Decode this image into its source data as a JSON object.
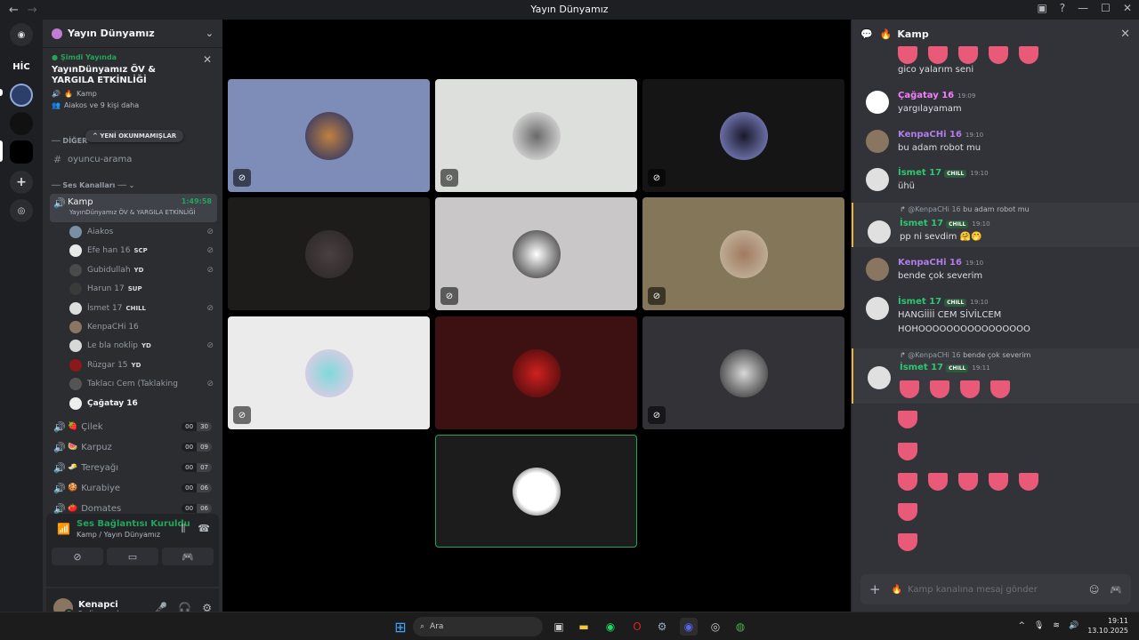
{
  "window": {
    "title": "Yayın Dünyamız"
  },
  "rail": {
    "servers": [
      "HİC"
    ]
  },
  "sidebar": {
    "server_name": "Yayın Dünyamız",
    "live": {
      "now_label": "Şimdi Yayında",
      "event_title": "YayınDünyamız ÖV & YARGILA ETKİNLİĞİ",
      "channel": "Kamp",
      "audience": "Aiakos ve 9 kişi daha"
    },
    "unread_label": "YENİ OKUNMAMIŞLAR",
    "category_other": "DİĞER",
    "text_channel": "oyuncu-arama",
    "category_voice": "Ses Kanalları",
    "active_channel": {
      "name": "Kamp",
      "timer": "1:49:58",
      "subtitle": "YayınDünyamız ÖV & YARGILA ETKİNLİĞİ"
    },
    "members": [
      {
        "name": "Aiakos",
        "tag": "",
        "color": "#7a8fa6"
      },
      {
        "name": "Efe han 16",
        "tag": "SCP",
        "color": "#e8e8e8"
      },
      {
        "name": "Gubidullah",
        "tag": "YD",
        "color": "#4a4a4a"
      },
      {
        "name": "Harun 17",
        "tag": "SUP",
        "color": "#3a3a3a"
      },
      {
        "name": "İsmet 17",
        "tag": "CHILL",
        "color": "#ddd"
      },
      {
        "name": "KenpaCHi 16",
        "tag": "",
        "color": "#8a7560"
      },
      {
        "name": "Le bla noklip",
        "tag": "YD",
        "color": "#d8d8d8"
      },
      {
        "name": "Rüzgar 15",
        "tag": "YD",
        "color": "#8a1a1a"
      },
      {
        "name": "Taklacı Cem (Taklaking",
        "tag": "",
        "color": "#555"
      },
      {
        "name": "Çağatay 16",
        "tag": "",
        "color": "#eee"
      }
    ],
    "voice_channels": [
      {
        "name": "Çilek",
        "a": "00",
        "b": "30"
      },
      {
        "name": "Karpuz",
        "a": "00",
        "b": "09"
      },
      {
        "name": "Tereyağı",
        "a": "00",
        "b": "07"
      },
      {
        "name": "Kurabiye",
        "a": "00",
        "b": "06"
      },
      {
        "name": "Domates",
        "a": "00",
        "b": "06"
      }
    ],
    "voice_status": "Ses Bağlantısı Kuruldu",
    "voice_location": "Kamp / Yayın Dünyamız",
    "user_name": "Kenapci",
    "user_status": "Sesli aramada"
  },
  "chat": {
    "channel": "Kamp",
    "messages": [
      {
        "text": "gico yalarım seni"
      },
      {
        "name": "Çağatay 16",
        "time": "19:09",
        "text": "yargılayamam",
        "color": "#f47fff"
      },
      {
        "name": "KenpaCHi 16",
        "time": "19:10",
        "text": "bu adam robot mu",
        "color": "#b07ee8"
      },
      {
        "name": "İsmet 17",
        "badge": "CHILL",
        "time": "19:10",
        "text": "ühü",
        "color": "#2dc770"
      },
      {
        "reply_at": "@KenpaCHi 16",
        "reply_text": "bu adam robot mu",
        "name": "İsmet 17",
        "badge": "CHILL",
        "time": "19:10",
        "text": "pp ni sevdim",
        "color": "#2dc770"
      },
      {
        "name": "KenpaCHi 16",
        "time": "19:10",
        "text": "bende çok severim",
        "color": "#b07ee8"
      },
      {
        "name": "İsmet 17",
        "badge": "CHILL",
        "time": "19:10",
        "text": "HANGİİİİ CEM SİVİLCEM",
        "text2": "HOHOOOOOOOOOOOOOOOO",
        "color": "#2dc770"
      },
      {
        "reply_at": "@KenpaCHi 16",
        "reply_text": "bende çok severim",
        "name": "İsmet 17",
        "badge": "CHILL",
        "time": "19:11",
        "color": "#2dc770"
      }
    ],
    "input_placeholder": "Kamp kanalına mesaj gönder"
  },
  "taskbar": {
    "search": "Ara",
    "time": "19:11",
    "date": "13.10.2025"
  }
}
